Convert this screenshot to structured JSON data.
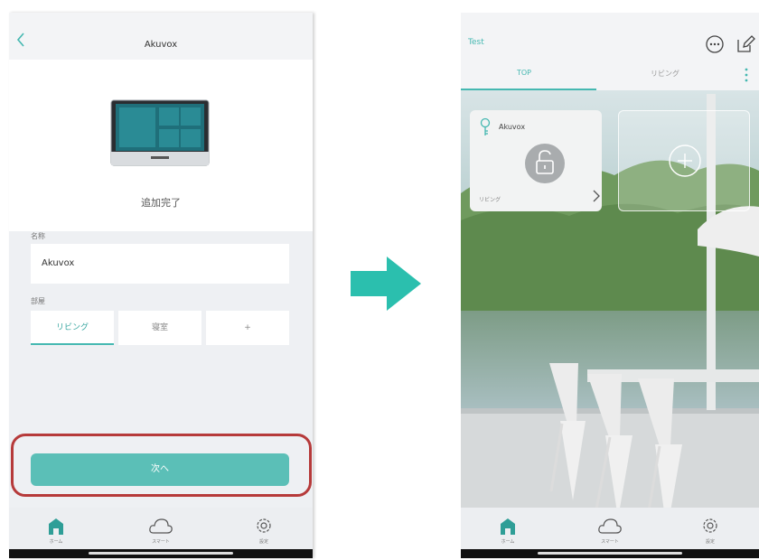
{
  "left": {
    "nav_title": "Akuvox",
    "status": "追加完了",
    "name_label": "名称",
    "name_value": "Akuvox",
    "room_label": "部屋",
    "rooms": [
      "リビング",
      "寝室",
      "+"
    ],
    "next_button": "次へ",
    "tabs": [
      "ホーム",
      "スマート",
      "設定"
    ]
  },
  "right": {
    "nav_title": "Test",
    "tabs": [
      "TOP",
      "リビング"
    ],
    "card": {
      "name": "Akuvox",
      "room": "リビング"
    },
    "bottom_tabs": [
      "ホーム",
      "スマート",
      "設定"
    ]
  },
  "colors": {
    "accent": "#45b8b1",
    "highlight": "#b63a3a",
    "arrow": "#2bbfae"
  },
  "icons": [
    "chevron-left-icon",
    "chat-bubble-icon",
    "edit-icon",
    "more-vertical-icon",
    "key-icon",
    "unlock-icon",
    "chevron-right-icon",
    "plus-icon",
    "home-icon",
    "cloud-icon",
    "gear-icon",
    "arrow-right-icon"
  ]
}
